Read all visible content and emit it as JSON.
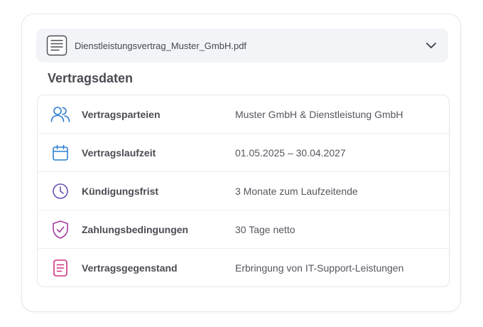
{
  "file": {
    "name": "Dienstleistungsvertrag_Muster_GmbH.pdf",
    "icon": "document-icon",
    "toggle_icon": "chevron-down-icon"
  },
  "section": {
    "title": "Vertragsdaten"
  },
  "details": [
    {
      "label": "Vertragsparteien",
      "value": "Muster GmbH & Dienstleistung GmbH",
      "icon": "users-icon",
      "color": "#2f7fd1"
    },
    {
      "label": "Vertragslaufzeit",
      "value": "01.05.2025 – 30.04.2027",
      "icon": "calendar-icon",
      "color": "#2f7fd1"
    },
    {
      "label": "Kündigungsfrist",
      "value": "3 Monate zum Laufzeitende",
      "icon": "clock-icon",
      "color": "#6a4fb3"
    },
    {
      "label": "Zahlungsbedingungen",
      "value": "30 Tage netto",
      "icon": "shield-check-icon",
      "color": "#a53aa0"
    },
    {
      "label": "Vertragsgegenstand",
      "value": "Erbringung von IT-Support-Leistungen",
      "icon": "document-text-icon",
      "color": "#d0307f"
    }
  ]
}
